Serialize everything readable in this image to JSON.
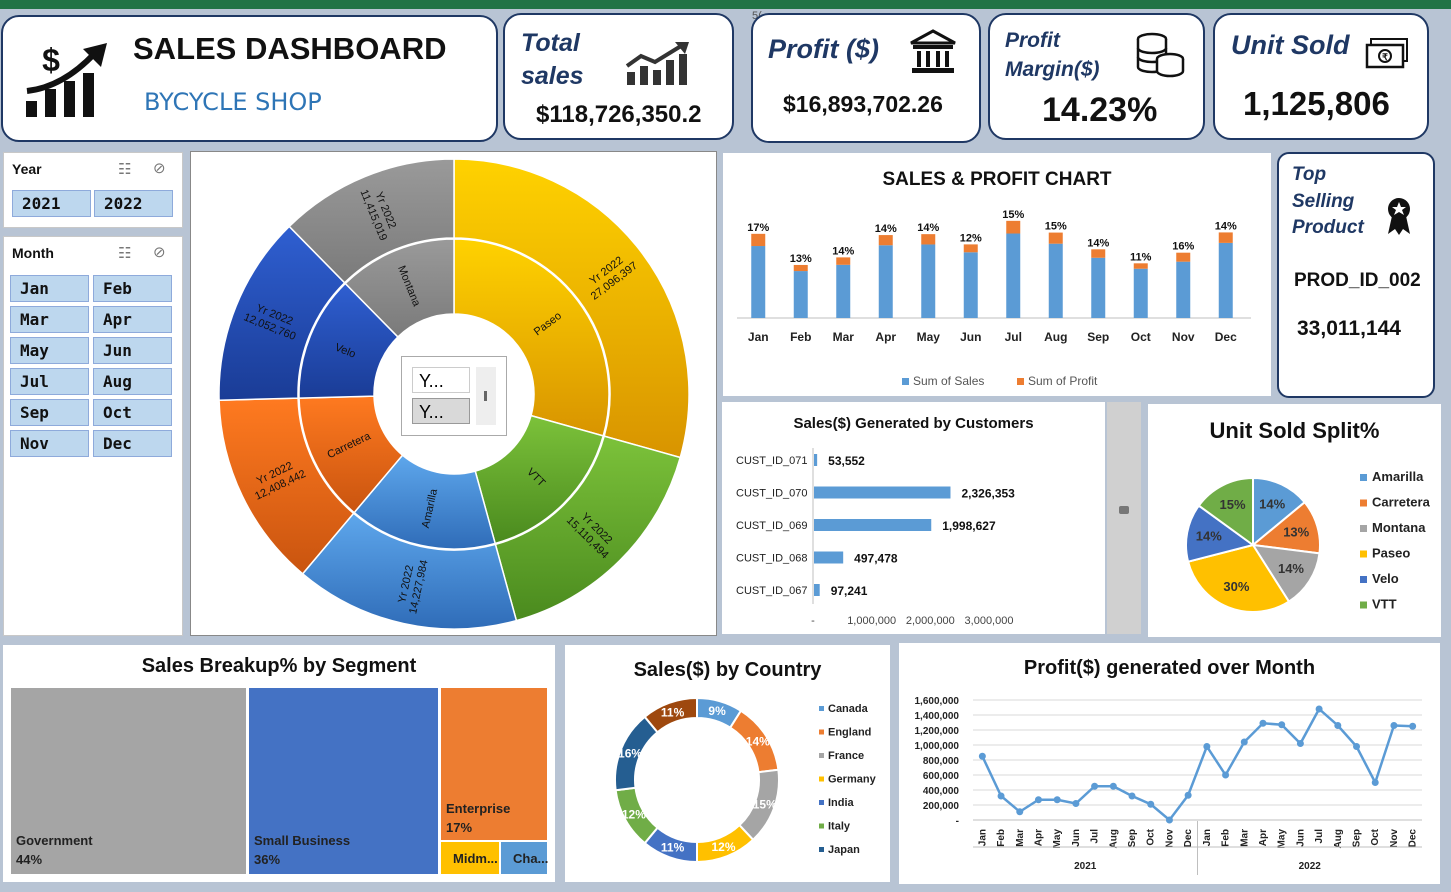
{
  "header": {
    "title": "SALES DASHBOARD",
    "subtitle": "BYCYCLE SHOP",
    "cell_text": "5("
  },
  "kpis": {
    "sales": {
      "title_line1": "Total",
      "title_line2": "sales",
      "value": "$118,726,350.2"
    },
    "profit": {
      "title": "Profit ($)",
      "value": "$16,893,702.26"
    },
    "margin": {
      "title_line1": "Profit",
      "title_line2": "Margin($)",
      "value": "14.23%"
    },
    "units": {
      "title": "Unit Sold",
      "value": "1,125,806"
    }
  },
  "top_product": {
    "title_line1": "Top",
    "title_line2": "Selling",
    "title_line3": "Product",
    "product": "PROD_ID_002",
    "value": "33,011,144"
  },
  "slicers": {
    "year": {
      "title": "Year",
      "items": [
        "2021",
        "2022"
      ]
    },
    "month": {
      "title": "Month",
      "items": [
        "Jan",
        "Feb",
        "Mar",
        "Apr",
        "May",
        "Jun",
        "Jul",
        "Aug",
        "Sep",
        "Oct",
        "Nov",
        "Dec"
      ]
    }
  },
  "sunburst": {
    "center_slicer": [
      "Y...",
      "Y..."
    ]
  },
  "colors": {
    "accent": "#217346",
    "navy": "#1f3864",
    "blue": "#5b9bd5",
    "orange": "#ed7d31",
    "gray": "#a5a5a5",
    "gold": "#ffc000",
    "darkblue": "#4472c4",
    "green": "#70ad47"
  },
  "chart_data": [
    {
      "type": "sunburst",
      "outer_labels": [
        "Yr 2022",
        "Yr 2022",
        "Yr 2022",
        "Yr 2022",
        "Yr 2022",
        "Yr 2022"
      ],
      "categories": [
        "Paseo",
        "VTT",
        "Amarilla",
        "Carretera",
        "Velo",
        "Montana"
      ],
      "values": [
        27096397,
        15110494,
        14227984,
        12408442,
        12052760,
        11415019
      ],
      "value_labels": [
        "27,096,397",
        "15,110,494",
        "14,227,984",
        "12,408,442",
        "12,052,760",
        "11,415,019"
      ]
    },
    {
      "type": "bar",
      "title": "SALES & PROFIT CHART",
      "categories": [
        "Jan",
        "Feb",
        "Mar",
        "Apr",
        "May",
        "Jun",
        "Jul",
        "Aug",
        "Sep",
        "Oct",
        "Nov",
        "Dec"
      ],
      "series": [
        {
          "name": "Sum of Sales",
          "values": [
            9200000,
            6000000,
            6800000,
            9300000,
            9400000,
            8400000,
            10800000,
            9500000,
            7700000,
            6300000,
            7200000,
            9600000
          ]
        },
        {
          "name": "Sum of Profit",
          "values": [
            1560000,
            780000,
            950000,
            1300000,
            1320000,
            1010000,
            1620000,
            1420000,
            1080000,
            690000,
            1150000,
            1340000
          ]
        }
      ],
      "labels": [
        "17%",
        "13%",
        "14%",
        "14%",
        "14%",
        "12%",
        "15%",
        "15%",
        "14%",
        "11%",
        "16%",
        "14%"
      ]
    },
    {
      "type": "bar",
      "orientation": "horizontal",
      "title": "Sales($) Generated by Customers",
      "categories": [
        "CUST_ID_071",
        "CUST_ID_070",
        "CUST_ID_069",
        "CUST_ID_068",
        "CUST_ID_067"
      ],
      "values": [
        53552,
        2326353,
        1998627,
        497478,
        97241
      ],
      "labels": [
        "53,552",
        "2,326,353",
        "1,998,627",
        "497,478",
        "97,241"
      ],
      "xticks": [
        "-",
        "1,000,000",
        "2,000,000",
        "3,000,000"
      ],
      "xlim": [
        0,
        3000000
      ]
    },
    {
      "type": "pie",
      "title": "Unit Sold Split%",
      "categories": [
        "Amarilla",
        "Carretera",
        "Montana",
        "Paseo",
        "Velo",
        "VTT"
      ],
      "values": [
        14,
        13,
        14,
        30,
        14,
        15
      ],
      "labels": [
        "14%",
        "13%",
        "14%",
        "30%",
        "14%",
        "15%"
      ]
    },
    {
      "type": "treemap",
      "title": "Sales Breakup% by Segment",
      "categories": [
        "Government",
        "Small Business",
        "Enterprise",
        "Midm...",
        "Cha..."
      ],
      "labels": [
        "44%",
        "36%",
        "17%",
        "",
        ""
      ],
      "values": [
        44,
        36,
        17,
        2,
        1
      ]
    },
    {
      "type": "donut",
      "title": "Sales($) by Country",
      "categories": [
        "Canada",
        "England",
        "France",
        "Germany",
        "India",
        "Italy",
        "Japan"
      ],
      "values": [
        9,
        14,
        15,
        12,
        11,
        12,
        16,
        11
      ],
      "labels": [
        "9%",
        "14%",
        "15%",
        "12%",
        "11%",
        "12%",
        "16%",
        "11%"
      ]
    },
    {
      "type": "line",
      "title": "Profit($) generated over Month",
      "categories": [
        "Jan",
        "Feb",
        "Mar",
        "Apr",
        "May",
        "Jun",
        "Jul",
        "Aug",
        "Sep",
        "Oct",
        "Nov",
        "Dec",
        "Jan",
        "Feb",
        "Mar",
        "Apr",
        "May",
        "Jun",
        "Jul",
        "Aug",
        "Sep",
        "Oct",
        "Nov",
        "Dec"
      ],
      "groups": [
        "2021",
        "2022"
      ],
      "values": [
        850000,
        320000,
        110000,
        270000,
        270000,
        220000,
        450000,
        450000,
        320000,
        210000,
        0,
        330000,
        980000,
        600000,
        1040000,
        1290000,
        1270000,
        1020000,
        1480000,
        1260000,
        980000,
        500000,
        1260000,
        1250000
      ],
      "yticks": [
        "1,600,000",
        "1,400,000",
        "1,200,000",
        "1,000,000",
        "800,000",
        "600,000",
        "400,000",
        "200,000",
        "-"
      ],
      "ylim": [
        0,
        1600000
      ]
    }
  ]
}
